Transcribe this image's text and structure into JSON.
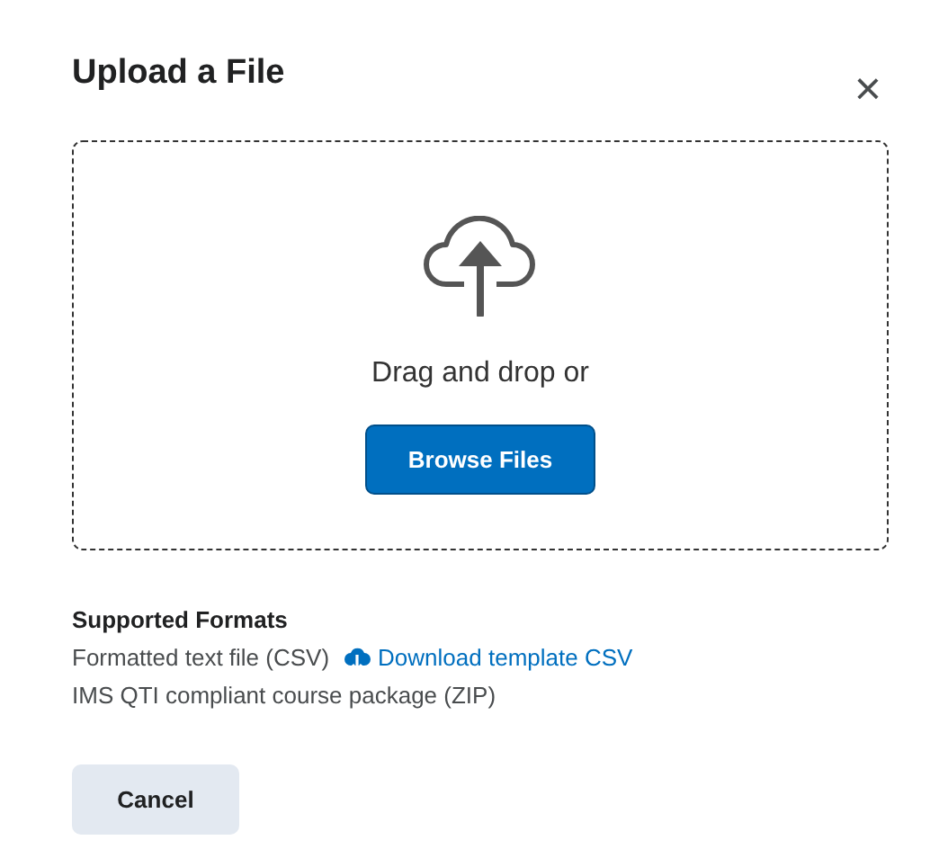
{
  "dialog": {
    "title": "Upload a File",
    "close": "×"
  },
  "dropzone": {
    "prompt": "Drag and drop or",
    "button": "Browse Files"
  },
  "formats": {
    "heading": "Supported Formats",
    "items": [
      {
        "label": "Formatted text file (CSV)",
        "link": "Download template CSV"
      },
      {
        "label": "IMS QTI compliant course package (ZIP)"
      }
    ]
  },
  "buttons": [
    {
      "label": "Cancel",
      "kind": "secondary"
    }
  ]
}
